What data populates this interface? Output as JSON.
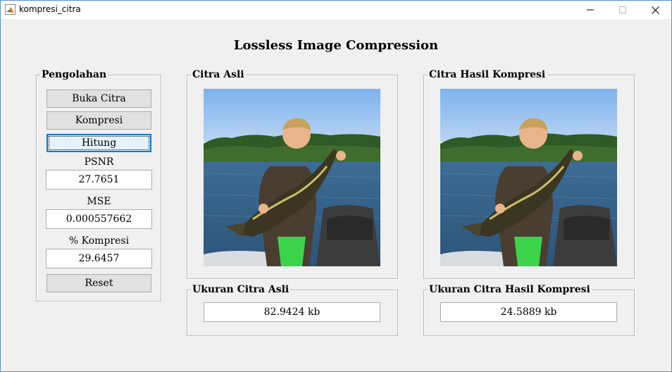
{
  "window": {
    "title": "kompresi_citra",
    "icon": "matlab-icon"
  },
  "main_title": "Lossless Image Compression",
  "panels": {
    "pengolahan": {
      "title": "Pengolahan",
      "buttons": {
        "buka": "Buka Citra",
        "kompresi": "Kompresi",
        "hitung": "Hitung",
        "reset": "Reset"
      },
      "psnr_label": "PSNR",
      "psnr_value": "27.7651",
      "mse_label": "MSE",
      "mse_value": "0.000557662",
      "kompresi_label": "% Kompresi",
      "kompresi_value": "29.6457"
    },
    "citra_asli": {
      "title": "Citra Asli"
    },
    "citra_hasil": {
      "title": "Citra Hasil Kompresi"
    },
    "ukuran_asli": {
      "title": "Ukuran Citra Asli",
      "value": "82.9424 kb"
    },
    "ukuran_hasil": {
      "title": "Ukuran Citra Hasil Kompresi",
      "value": "24.5889 kb"
    }
  },
  "colors": {
    "accent": "#0078d7",
    "window_border": "#5a8fd0",
    "background": "#f0f0f0"
  }
}
